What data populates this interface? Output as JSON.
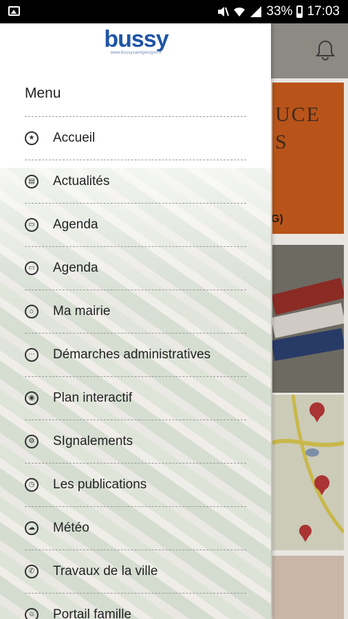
{
  "status_bar": {
    "battery": "33%",
    "time": "17:03"
  },
  "logo": {
    "word": "bussy",
    "tagline": "www.bussysaintgeorges.fr"
  },
  "menu": {
    "title": "Menu",
    "items": [
      {
        "label": "Accueil",
        "icon": "star-icon",
        "glyph": "★"
      },
      {
        "label": "Actualités",
        "icon": "news-icon",
        "glyph": "▤"
      },
      {
        "label": "Agenda",
        "icon": "calendar-icon",
        "glyph": "▭"
      },
      {
        "label": "Agenda",
        "icon": "calendar-icon",
        "glyph": "▭"
      },
      {
        "label": "Ma mairie",
        "icon": "town-hall-icon",
        "glyph": "⌂"
      },
      {
        "label": "Démarches administratives",
        "icon": "chat-icon",
        "glyph": "⋯"
      },
      {
        "label": "Plan interactif",
        "icon": "map-pin-icon",
        "glyph": "◉"
      },
      {
        "label": "SIgnalements",
        "icon": "report-icon",
        "glyph": "⚙"
      },
      {
        "label": "Les publications",
        "icon": "publications-icon",
        "glyph": "◷"
      },
      {
        "label": "Météo",
        "icon": "weather-icon",
        "glyph": "☁"
      },
      {
        "label": "Travaux de la ville",
        "icon": "works-icon",
        "glyph": "✆"
      },
      {
        "label": "Portail famille",
        "icon": "family-icon",
        "glyph": "☺"
      }
    ]
  },
  "background": {
    "card1_line1": "UCE",
    "card1_line2": "S",
    "card1_line3": "G)"
  },
  "colors": {
    "logo_blue": "#1f55a6",
    "card_orange": "#b8541a"
  }
}
